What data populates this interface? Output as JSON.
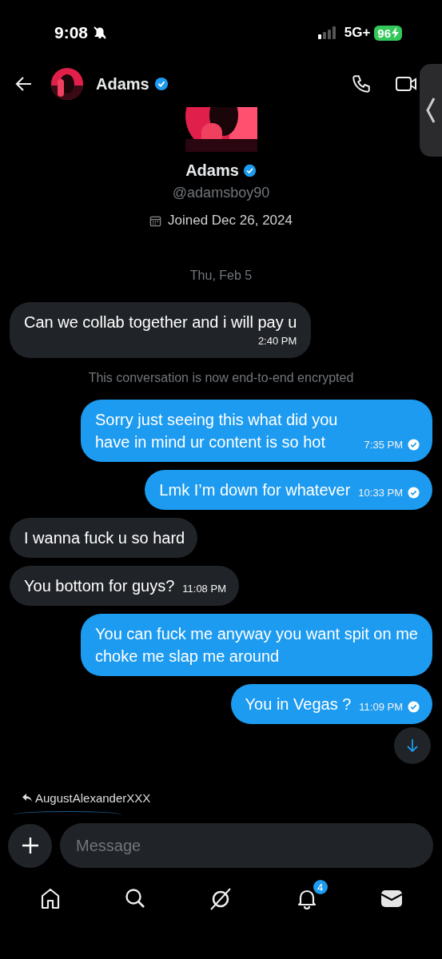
{
  "status_bar": {
    "time": "9:08",
    "silent": true,
    "network": "5G+",
    "battery": "96",
    "charging": true
  },
  "header": {
    "name": "Adams",
    "verified": true
  },
  "profile": {
    "name": "Adams",
    "verified": true,
    "handle": "@adamsboy90",
    "joined": "Joined Dec 26, 2024"
  },
  "messages": [
    {
      "kind": "date",
      "text": "Thu, Feb 5"
    },
    {
      "kind": "message",
      "outgoing": false,
      "text": "Can we collab together and i will pay u",
      "time": "2:40 PM",
      "time_below": true
    },
    {
      "kind": "notice",
      "text": "This conversation is now end-to-end encrypted"
    },
    {
      "kind": "message",
      "outgoing": true,
      "text": "Sorry just seeing this what did you have in mind ur content is so hot",
      "time": "7:35 PM",
      "read": true
    },
    {
      "kind": "message",
      "outgoing": true,
      "text": "Lmk I’m down for whatever",
      "time": "10:33 PM",
      "read": true
    },
    {
      "kind": "message",
      "outgoing": false,
      "text": "I wanna fuck u so hard"
    },
    {
      "kind": "message",
      "outgoing": false,
      "text": "You bottom for guys?",
      "time": "11:08 PM"
    },
    {
      "kind": "message",
      "outgoing": true,
      "text": "You can fuck me anyway you want spit on me choke me slap me around"
    },
    {
      "kind": "message",
      "outgoing": true,
      "text": "You in Vegas ?",
      "time": "11:09 PM",
      "read": true
    }
  ],
  "reply_preview": {
    "name": "AugustAlexanderXXX"
  },
  "composer": {
    "placeholder": "Message"
  },
  "notifications": {
    "badge": "4"
  }
}
